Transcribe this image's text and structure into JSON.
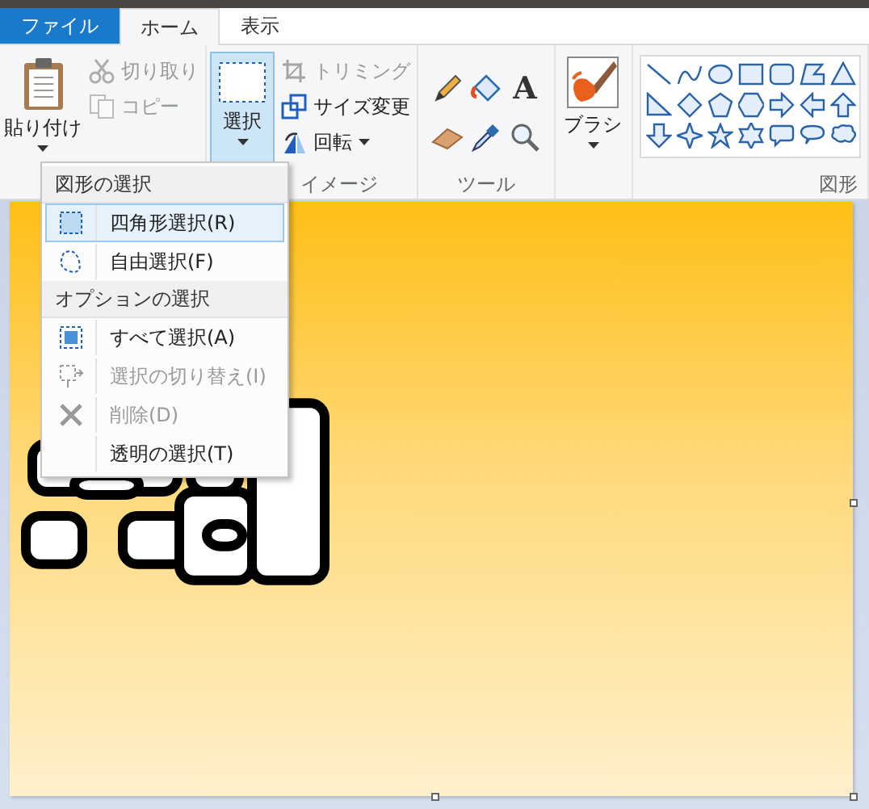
{
  "tabs": [
    {
      "label": "ファイル",
      "kind": "file",
      "selected": false
    },
    {
      "label": "ホーム",
      "kind": "tab",
      "selected": true
    },
    {
      "label": "表示",
      "kind": "tab",
      "selected": false
    }
  ],
  "clipboard": {
    "paste": {
      "label": "貼り付け"
    },
    "cut": {
      "label": "切り取り",
      "disabled": true
    },
    "copy": {
      "label": "コピー",
      "disabled": true
    }
  },
  "image": {
    "select": {
      "label": "選択",
      "expanded": true
    },
    "crop": {
      "label": "トリミング",
      "disabled": true
    },
    "resize": {
      "label": "サイズ変更",
      "disabled": false
    },
    "rotate": {
      "label": "回転",
      "disabled": false
    },
    "group_label": "イメージ"
  },
  "tools": {
    "text_glyph": "A",
    "group_label": "ツール"
  },
  "brushes": {
    "label": "ブラシ"
  },
  "shapes": {
    "group_label": "図形"
  },
  "select_menu": [
    {
      "kind": "header",
      "label": "図形の選択"
    },
    {
      "kind": "rectangle",
      "label": "四角形選択(R)",
      "selected": true,
      "disabled": false
    },
    {
      "kind": "freeform",
      "label": "自由選択(F)",
      "selected": false,
      "disabled": false
    },
    {
      "kind": "header",
      "label": "オプションの選択"
    },
    {
      "kind": "selectall",
      "label": "すべて選択(A)",
      "selected": false,
      "disabled": false
    },
    {
      "kind": "invert",
      "label": "選択の切り替え(I)",
      "selected": false,
      "disabled": true
    },
    {
      "kind": "delete",
      "label": "削除(D)",
      "selected": false,
      "disabled": true
    },
    {
      "kind": "plain",
      "label": "透明の選択(T)",
      "selected": false,
      "disabled": false
    }
  ]
}
